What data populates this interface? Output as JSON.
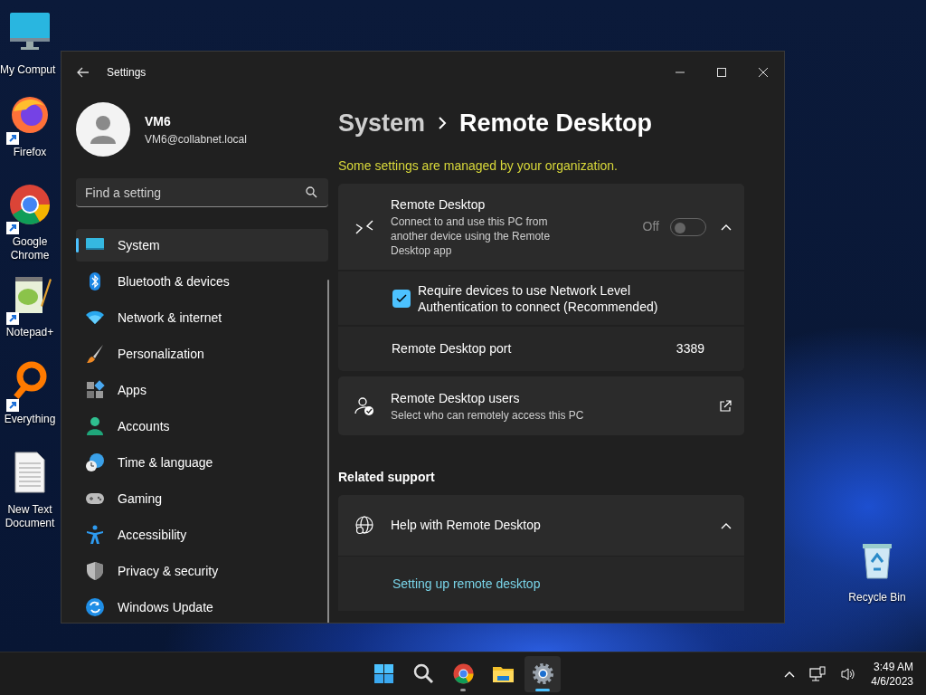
{
  "desktop_icons": [
    {
      "label": "My Comput",
      "kind": "computer",
      "shortcut": false
    },
    {
      "label": "Firefox",
      "kind": "firefox",
      "shortcut": true
    },
    {
      "label": "Google Chrome",
      "kind": "chrome",
      "shortcut": true
    },
    {
      "label": "Notepad+",
      "kind": "notepad",
      "shortcut": true
    },
    {
      "label": "Everything",
      "kind": "search",
      "shortcut": true
    },
    {
      "label": "New Text Document",
      "kind": "textfile",
      "shortcut": false
    },
    {
      "label": "Recycle Bin",
      "kind": "recycle",
      "shortcut": false
    }
  ],
  "window": {
    "title": "Settings",
    "profile": {
      "name": "VM6",
      "email": "VM6@collabnet.local"
    },
    "search": {
      "placeholder": "Find a setting"
    },
    "nav": [
      {
        "label": "System",
        "kind": "system",
        "selected": true
      },
      {
        "label": "Bluetooth & devices",
        "kind": "bluetooth",
        "selected": false
      },
      {
        "label": "Network & internet",
        "kind": "network",
        "selected": false
      },
      {
        "label": "Personalization",
        "kind": "brush",
        "selected": false
      },
      {
        "label": "Apps",
        "kind": "apps",
        "selected": false
      },
      {
        "label": "Accounts",
        "kind": "accounts",
        "selected": false
      },
      {
        "label": "Time & language",
        "kind": "time",
        "selected": false
      },
      {
        "label": "Gaming",
        "kind": "gaming",
        "selected": false
      },
      {
        "label": "Accessibility",
        "kind": "accessibility",
        "selected": false
      },
      {
        "label": "Privacy & security",
        "kind": "privacy",
        "selected": false
      },
      {
        "label": "Windows Update",
        "kind": "update",
        "selected": false
      }
    ],
    "breadcrumb": [
      "System",
      "Remote Desktop"
    ],
    "notice": "Some settings are managed by your organization.",
    "remote_desktop": {
      "title": "Remote Desktop",
      "description": "Connect to and use this PC from another device using the Remote Desktop app",
      "toggle_label": "Off",
      "on": false,
      "expanded": true,
      "nla": {
        "label": "Require devices to use Network Level Authentication to connect (Recommended)",
        "checked": true
      },
      "port": {
        "label": "Remote Desktop port",
        "value": "3389"
      }
    },
    "users": {
      "title": "Remote Desktop users",
      "subtitle": "Select who can remotely access this PC"
    },
    "related_heading": "Related support",
    "help": {
      "title": "Help with Remote Desktop",
      "expanded": true,
      "link": "Setting up remote desktop"
    }
  },
  "taskbar": {
    "apps": [
      {
        "kind": "start",
        "selected": false,
        "running": false
      },
      {
        "kind": "search",
        "selected": false,
        "running": false
      },
      {
        "kind": "chrome",
        "selected": false,
        "running": true
      },
      {
        "kind": "folder",
        "selected": false,
        "running": false
      },
      {
        "kind": "settings",
        "selected": true,
        "running": true
      }
    ],
    "time": "3:49 AM",
    "date": "4/6/2023"
  }
}
